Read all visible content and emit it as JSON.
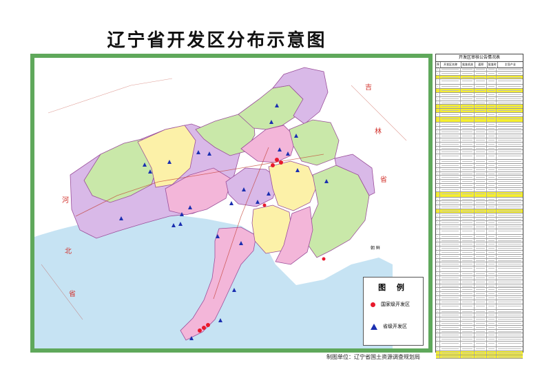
{
  "title": "辽宁省开发区分布示意图",
  "footer": "制图单位：辽宁省国土资源调查规划局",
  "legend": {
    "title": "图 例",
    "national": "国家级开发区",
    "provincial": "省级开发区"
  },
  "map_labels": {
    "hebei_1": "河",
    "hebei_2": "北",
    "hebei_3": "省",
    "jilin_1": "吉",
    "jilin_2": "林",
    "jilin_3": "省",
    "korea": "朝 鲜"
  },
  "table": {
    "title": "开发区审核公告情况表",
    "headers": [
      "序号",
      "开发区名称",
      "批准机关",
      "面积",
      "批准时间",
      "主导产业"
    ]
  },
  "colors": {
    "frame": "#5fa85b",
    "sea": "#c6e3f3",
    "pink": "#f3b6d9",
    "lavender": "#d9b9e8",
    "green": "#c9e8a9",
    "yellow": "#fcf1a8",
    "national": "#e8192c",
    "provincial": "#1b2fb0"
  }
}
